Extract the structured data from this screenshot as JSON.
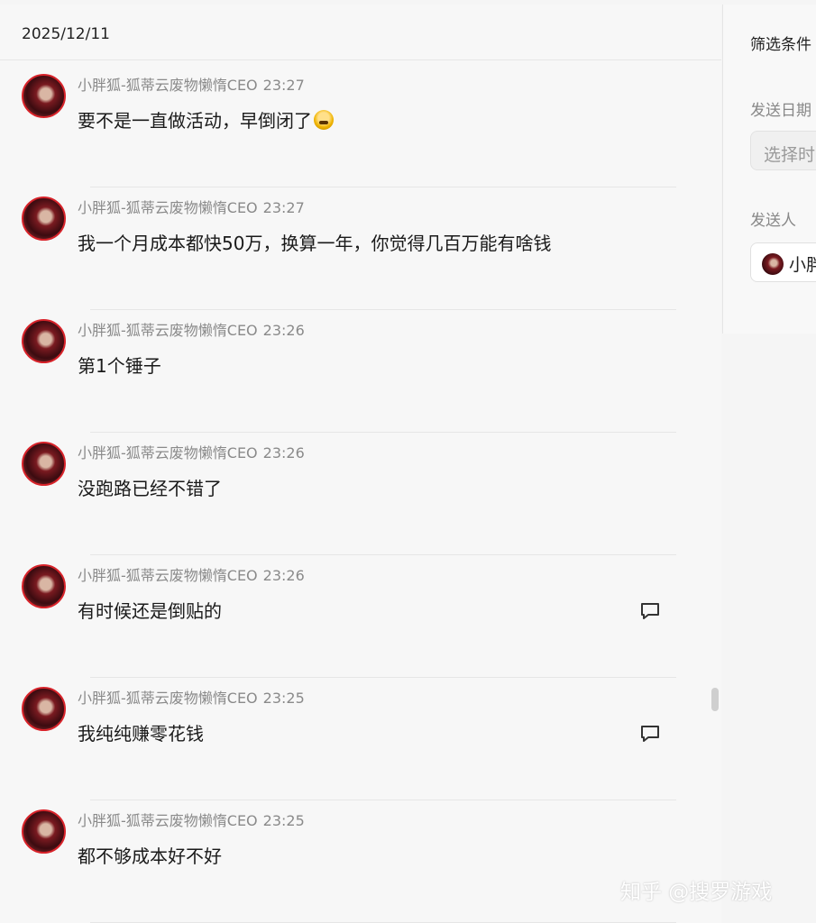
{
  "header": {
    "date": "2025/12/11"
  },
  "messages": [
    {
      "sender": "小胖狐-狐蒂云废物懒惰CEO",
      "time": "23:27",
      "text": "要不是一直做活动，早倒闭了",
      "emoji": "laughing-dog-emoji",
      "has_reply_icon": false
    },
    {
      "sender": "小胖狐-狐蒂云废物懒惰CEO",
      "time": "23:27",
      "text": "我一个月成本都快50万，换算一年，你觉得几百万能有啥钱",
      "has_reply_icon": false
    },
    {
      "sender": "小胖狐-狐蒂云废物懒惰CEO",
      "time": "23:26",
      "text": "第1个锤子",
      "has_reply_icon": false
    },
    {
      "sender": "小胖狐-狐蒂云废物懒惰CEO",
      "time": "23:26",
      "text": "没跑路已经不错了",
      "has_reply_icon": false
    },
    {
      "sender": "小胖狐-狐蒂云废物懒惰CEO",
      "time": "23:26",
      "text": "有时候还是倒贴的",
      "has_reply_icon": true
    },
    {
      "sender": "小胖狐-狐蒂云废物懒惰CEO",
      "time": "23:25",
      "text": "我纯纯赚零花钱",
      "has_reply_icon": true
    },
    {
      "sender": "小胖狐-狐蒂云废物懒惰CEO",
      "time": "23:25",
      "text": "都不够成本好不好",
      "has_reply_icon": false
    }
  ],
  "filter": {
    "title": "筛选条件",
    "date_label": "发送日期",
    "date_placeholder": "选择时",
    "sender_label": "发送人",
    "sender_value": "小胖"
  },
  "watermark": "知乎 @搜罗游戏",
  "colors": {
    "avatar_border": "#d8232a",
    "meta_text": "#8a8a8a",
    "background": "#f7f7f7"
  },
  "icons": {
    "reply": "comment-bubble-icon",
    "avatar": "user-avatar"
  }
}
